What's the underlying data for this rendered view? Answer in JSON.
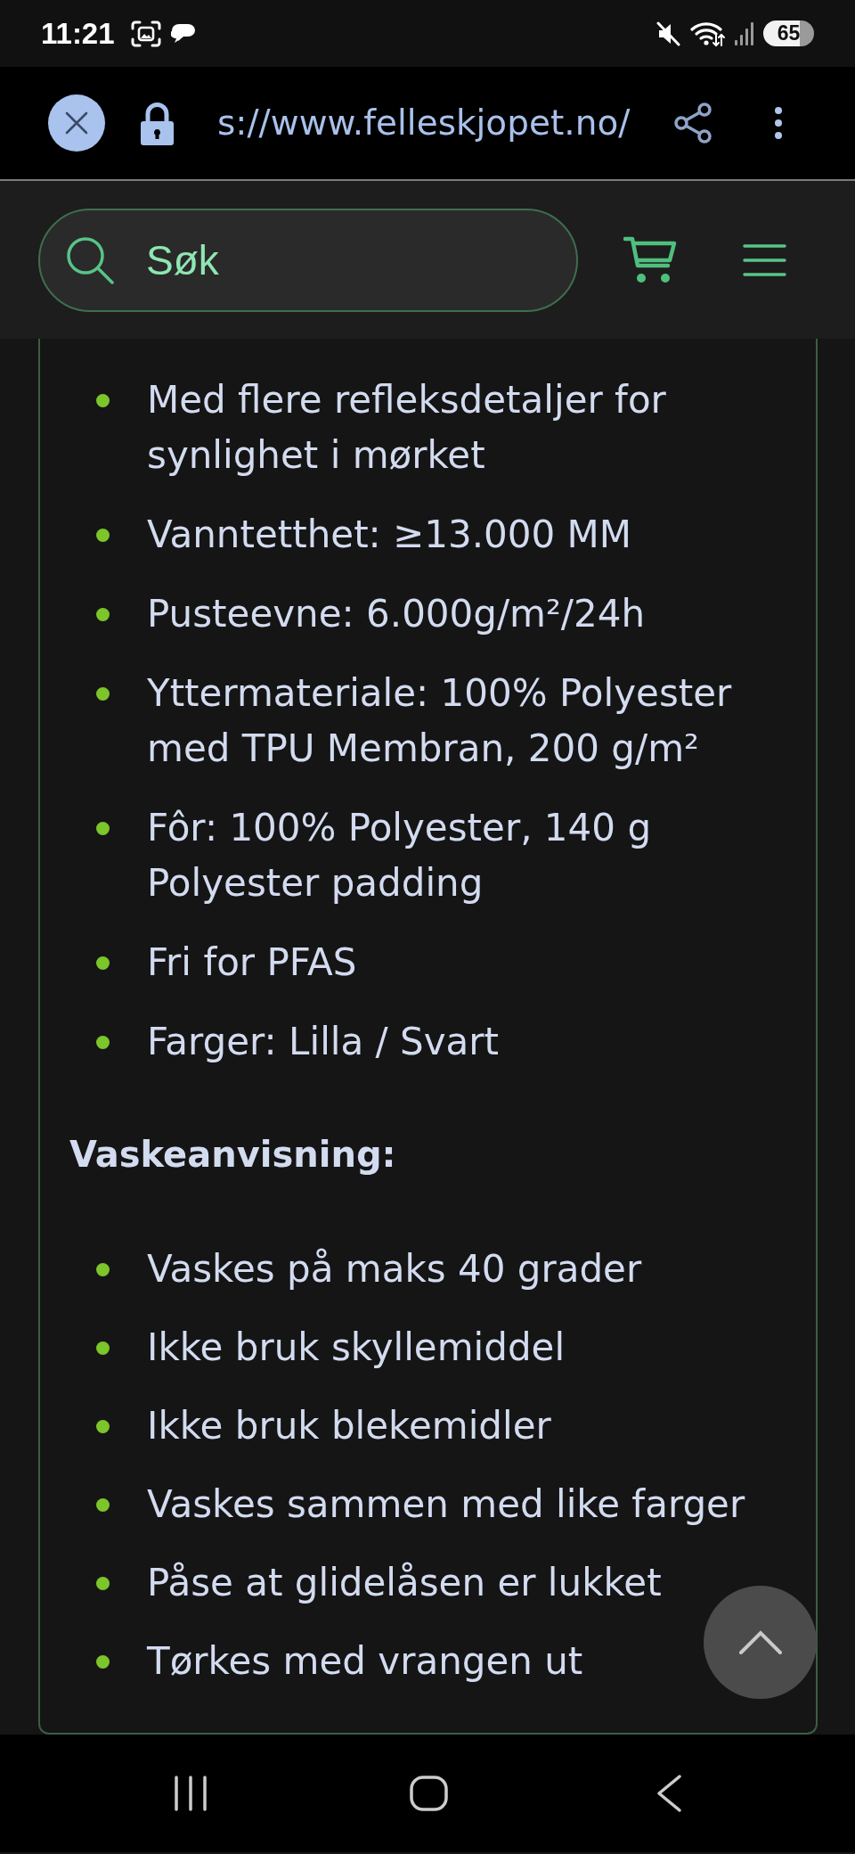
{
  "status_bar": {
    "time": "11:21",
    "battery": "65"
  },
  "browser_toolbar": {
    "url": "s://www.felleskjopet.no/"
  },
  "site_header": {
    "search": {
      "placeholder": "Søk"
    }
  },
  "product_details": {
    "features": [
      "Med flere refleksdetaljer for synlighet i mørket",
      "Vanntetthet: ≥13.000 MM",
      "Pusteevne: 6.000g/m²/24h",
      "Yttermateriale: 100% Polyester med TPU Membran, 200 g/m²",
      "Fôr: 100% Polyester, 140 g Polyester padding",
      "Fri for PFAS",
      "Farger: Lilla / Svart"
    ],
    "care_heading": "Vaskeanvisning:",
    "care_instructions": [
      "Vaskes på maks 40 grader",
      "Ikke bruk skyllemiddel",
      "Ikke bruk blekemidler",
      "Vaskes sammen med like farger",
      "Påse at glidelåsen er lukket",
      "Tørkes med vrangen ut"
    ]
  }
}
